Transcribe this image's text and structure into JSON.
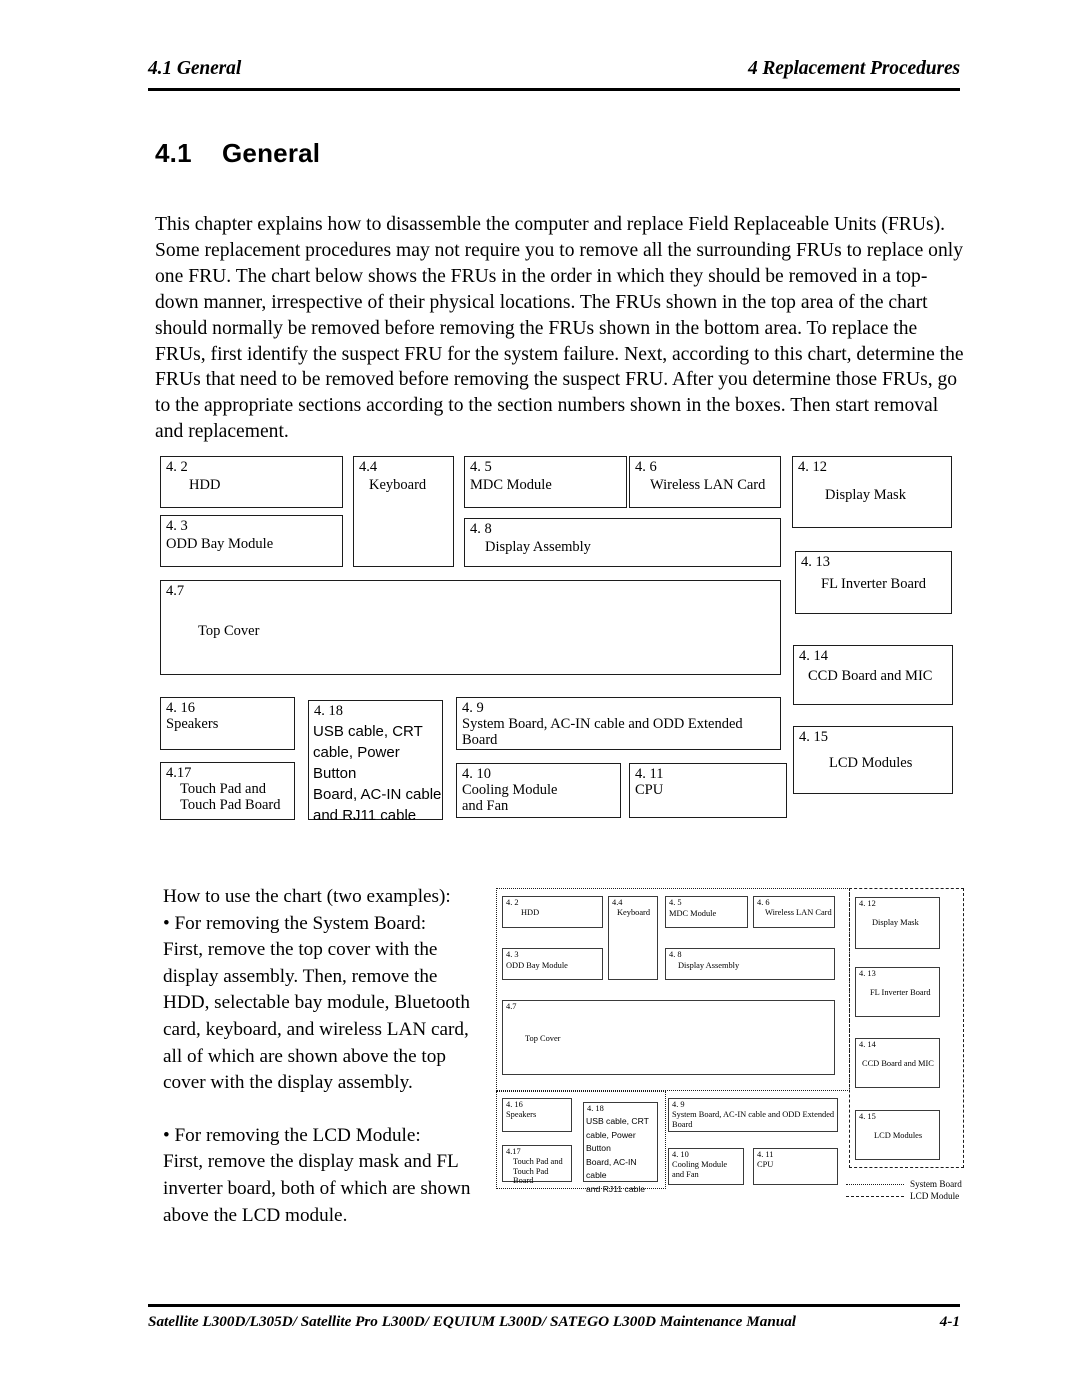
{
  "header": {
    "left": "4.1 General",
    "right": "4 Replacement Procedures"
  },
  "section": {
    "number": "4.1",
    "title": "General"
  },
  "intro": "This chapter explains how to disassemble the computer and replace Field Replaceable Units (FRUs). Some replacement procedures may not require you to remove all the surrounding FRUs to replace only one FRU. The chart below shows the FRUs in the order in which they should be removed in a top-down manner, irrespective of their physical locations.  The FRUs shown in the top area of the chart should normally be removed before removing the FRUs shown in the bottom area. To replace the FRUs, first identify the suspect FRU for the system failure. Next, according to this chart, determine the FRUs that need to be removed before removing the suspect FRU. After you determine those FRUs, go to the appropriate sections according to the section numbers shown in the boxes. Then start removal and replacement.",
  "chart": {
    "boxes": [
      {
        "id": "4.2",
        "section": "4. 2",
        "name": "HDD"
      },
      {
        "id": "4.3",
        "section": "4. 3",
        "name": "ODD Bay Module"
      },
      {
        "id": "4.4",
        "section": "4.4",
        "name": "Keyboard"
      },
      {
        "id": "4.5",
        "section": "4. 5",
        "name": "MDC Module"
      },
      {
        "id": "4.6",
        "section": "4. 6",
        "name": "Wireless LAN Card"
      },
      {
        "id": "4.8",
        "section": "4. 8",
        "name": "Display Assembly"
      },
      {
        "id": "4.12",
        "section": "4. 12",
        "name": "Display Mask"
      },
      {
        "id": "4.13",
        "section": "4. 13",
        "name": "FL Inverter Board"
      },
      {
        "id": "4.14",
        "section": "4. 14",
        "name": "CCD Board and MIC"
      },
      {
        "id": "4.15",
        "section": "4. 15",
        "name": "LCD Modules"
      },
      {
        "id": "4.7",
        "section": "4.7",
        "name": "Top Cover"
      },
      {
        "id": "4.16",
        "section": "4. 16",
        "name": "Speakers"
      },
      {
        "id": "4.17",
        "section": "4.17",
        "name": "Touch Pad and\nTouch Pad Board"
      },
      {
        "id": "4.18",
        "section": "4. 18",
        "name": "USB cable, CRT\ncable, Power Button\nBoard, AC-IN cable\nand RJ11 cable"
      },
      {
        "id": "4.9",
        "section": "4. 9",
        "name": "System Board, AC-IN cable and ODD Extended Board"
      },
      {
        "id": "4.10",
        "section": "4. 10",
        "name": "Cooling Module\nand Fan"
      },
      {
        "id": "4.11",
        "section": "4. 11",
        "name": "CPU"
      }
    ]
  },
  "howto": {
    "lead": "How to use the chart (two examples):",
    "example1_title": "• For removing the System Board:",
    "example1_body": "First, remove the top cover with the display assembly. Then, remove the HDD, selectable bay module, Bluetooth card, keyboard, and wireless LAN card, all of which are shown above the top cover with the display assembly.",
    "example2_title": "• For removing the LCD Module:",
    "example2_body": "First, remove the display mask and FL inverter board, both of which are shown above the LCD module."
  },
  "legend": {
    "system_board": "System Board",
    "lcd_module": "LCD Module"
  },
  "footer": {
    "left": "Satellite L300D/L305D/ Satellite Pro L300D/ EQUIUM L300D/ SATEGO L300D Maintenance Manual",
    "right": "4-1"
  }
}
